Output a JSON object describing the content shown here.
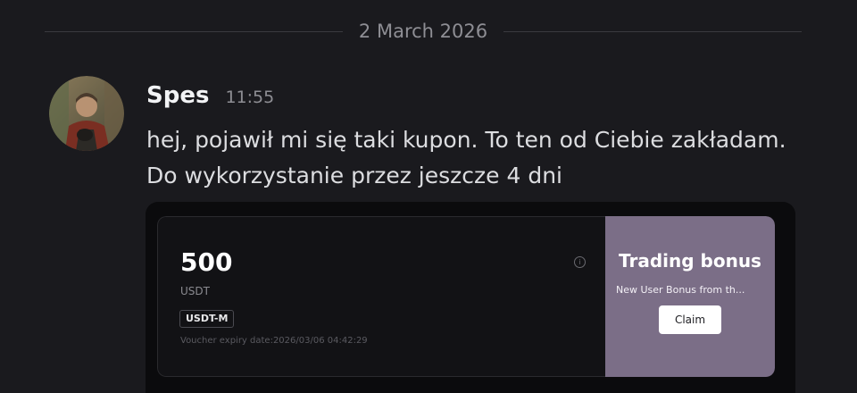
{
  "divider": {
    "date": "2 March 2026"
  },
  "message": {
    "author": "Spes",
    "time": "11:55",
    "text": "hej, pojawił mi się taki kupon. To ten od Ciebie zakładam. Do wykorzystanie przez jeszcze 4 dni"
  },
  "voucher": {
    "amount": "500",
    "currency": "USDT",
    "tag": "USDT-M",
    "expiry": "Voucher expiry date:2026/03/06 04:42:29",
    "title": "Trading bonus",
    "subtitle": "New User Bonus from th...",
    "claim_label": "Claim",
    "info_icon": "info-icon"
  },
  "colors": {
    "background": "#1a1a1e",
    "panel_accent": "#7b6e87"
  }
}
